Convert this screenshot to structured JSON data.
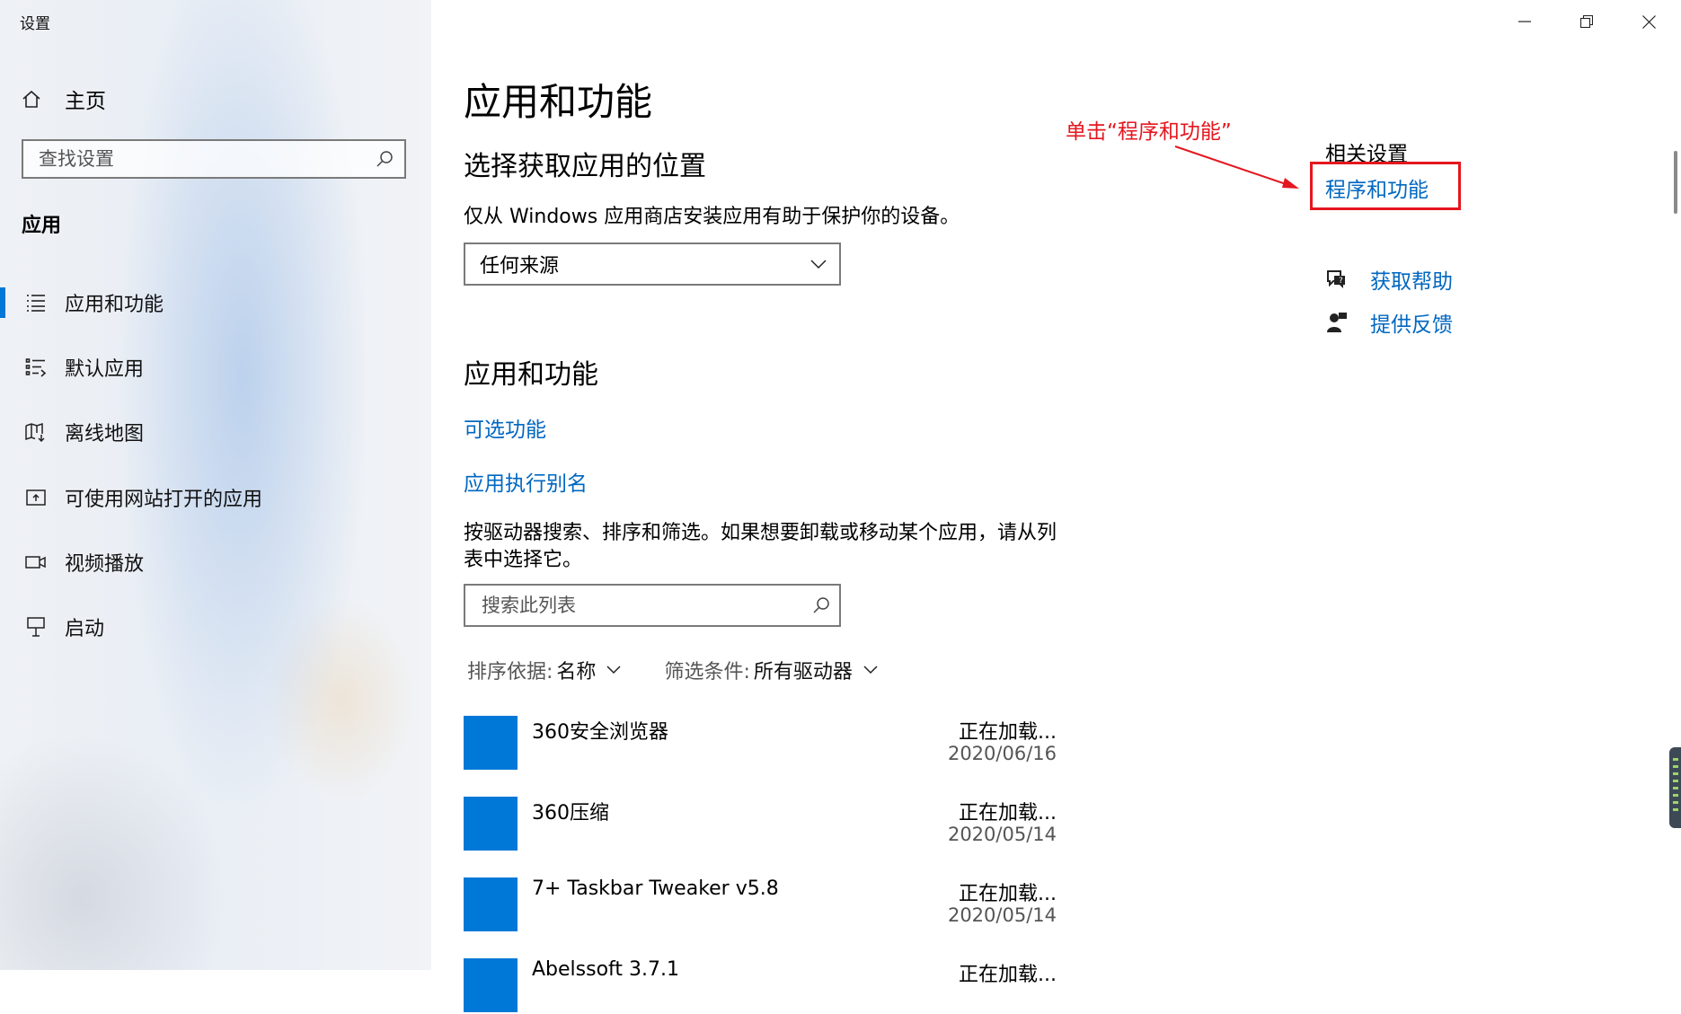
{
  "window": {
    "title": "设置",
    "minimize_label": "—",
    "restore_label": "❐",
    "close_label": "✕"
  },
  "sidebar": {
    "home_label": "主页",
    "search_placeholder": "查找设置",
    "section_title": "应用",
    "items": [
      {
        "label": "应用和功能",
        "icon": "apps-features-icon",
        "active": true
      },
      {
        "label": "默认应用",
        "icon": "default-apps-icon",
        "active": false
      },
      {
        "label": "离线地图",
        "icon": "offline-maps-icon",
        "active": false
      },
      {
        "label": "可使用网站打开的应用",
        "icon": "apps-for-websites-icon",
        "active": false
      },
      {
        "label": "视频播放",
        "icon": "video-playback-icon",
        "active": false
      },
      {
        "label": "启动",
        "icon": "startup-icon",
        "active": false
      }
    ]
  },
  "main": {
    "page_title": "应用和功能",
    "install_section": {
      "heading": "选择获取应用的位置",
      "description": "仅从 Windows 应用商店安装应用有助于保护你的设备。",
      "dropdown_value": "任何来源"
    },
    "apps_section": {
      "heading": "应用和功能",
      "optional_features_link": "可选功能",
      "app_aliases_link": "应用执行别名",
      "description": "按驱动器搜索、排序和筛选。如果想要卸载或移动某个应用，请从列表中选择它。",
      "search_placeholder": "搜索此列表",
      "sort_label": "排序依据:",
      "sort_value": "名称",
      "filter_label": "筛选条件:",
      "filter_value": "所有驱动器",
      "apps": [
        {
          "name": "360安全浏览器",
          "size": "正在加载...",
          "date": "2020/06/16"
        },
        {
          "name": "360压缩",
          "size": "正在加载...",
          "date": "2020/05/14"
        },
        {
          "name": "7+ Taskbar Tweaker v5.8",
          "size": "正在加载...",
          "date": "2020/05/14"
        },
        {
          "name": "Abelssoft 3.7.1",
          "size": "正在加载...",
          "date": ""
        }
      ]
    }
  },
  "related": {
    "heading": "相关设置",
    "programs_link": "程序和功能",
    "help_link": "获取帮助",
    "feedback_link": "提供反馈"
  },
  "annotation": {
    "text": "单击“程序和功能”",
    "color": "#e4171f"
  },
  "colors": {
    "accent": "#0078d7",
    "link": "#0067c0",
    "annotation_red": "#e4171f"
  }
}
